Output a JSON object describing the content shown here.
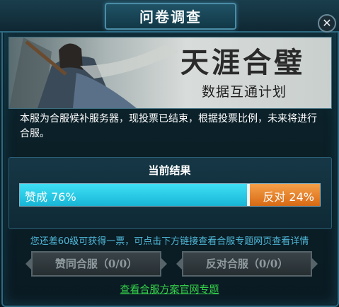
{
  "window": {
    "title": "问卷调查",
    "close_icon": "close-icon"
  },
  "banner": {
    "title": "天涯合璧",
    "subtitle": "数据互通计划"
  },
  "description": "本服为合服候补服务器，现投票已结束，根据投票比例，未来将进行合服。",
  "results": {
    "label": "当前结果",
    "yes_text": "赞成 76%",
    "no_text": "反对 24%",
    "yes_fraction": 0.76,
    "no_fraction": 0.24,
    "yes_color": "#18b6d6",
    "no_color": "#d86a14"
  },
  "notice": "您还差60级可获得一票，可点击下方链接查看合服专题网页查看详情",
  "buttons": {
    "agree": "赞同合服（0/0）",
    "oppose": "反对合服（0/0）"
  },
  "link": "查看合服方案官网专题"
}
